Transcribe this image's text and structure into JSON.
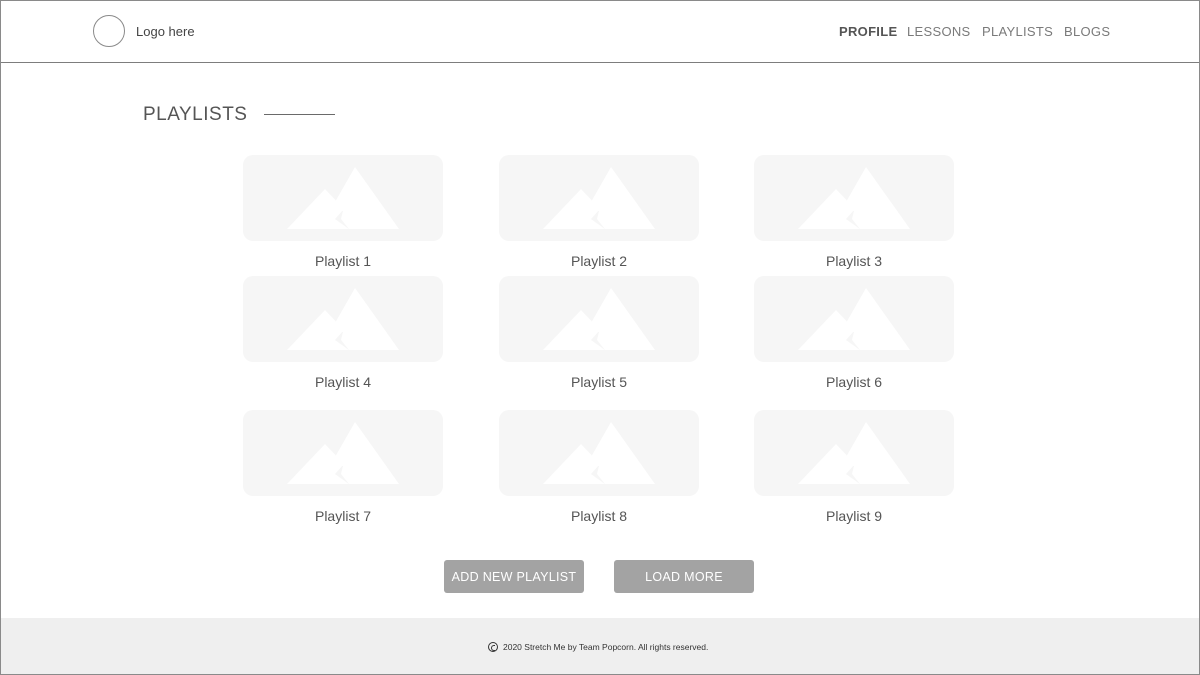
{
  "header": {
    "logo_text": "Logo here",
    "nav": [
      {
        "label": "PROFILE",
        "active": true
      },
      {
        "label": "LESSONS",
        "active": false
      },
      {
        "label": "PLAYLISTS",
        "active": false
      },
      {
        "label": "BLOGS",
        "active": false
      }
    ]
  },
  "section": {
    "title": "PLAYLISTS"
  },
  "playlists": [
    {
      "label": "Playlist 1",
      "icon": "image-placeholder-icon"
    },
    {
      "label": "Playlist 2",
      "icon": "image-placeholder-icon"
    },
    {
      "label": "Playlist 3",
      "icon": "image-placeholder-icon"
    },
    {
      "label": "Playlist 4",
      "icon": "image-placeholder-icon"
    },
    {
      "label": "Playlist 5",
      "icon": "image-placeholder-icon"
    },
    {
      "label": "Playlist 6",
      "icon": "image-placeholder-icon"
    },
    {
      "label": "Playlist 7",
      "icon": "image-placeholder-icon"
    },
    {
      "label": "Playlist 8",
      "icon": "image-placeholder-icon"
    },
    {
      "label": "Playlist 9",
      "icon": "image-placeholder-icon"
    }
  ],
  "actions": {
    "add_label": "ADD NEW PLAYLIST",
    "load_label": "LOAD MORE"
  },
  "footer": {
    "text": "2020 Stretch Me by Team Popcorn. All rights reserved."
  },
  "colors": {
    "button_bg": "#a3a3a3",
    "card_bg": "#f6f6f6",
    "footer_bg": "#efefef"
  }
}
